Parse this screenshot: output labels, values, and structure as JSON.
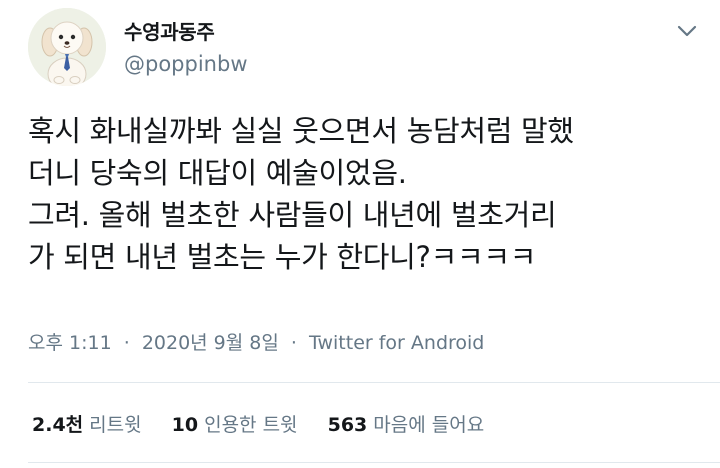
{
  "user": {
    "name": "수영과동주",
    "handle": "@poppinbw"
  },
  "tweet": {
    "lines": [
      "혹시 화내실까봐 실실 웃으면서 농담처럼 말했",
      "더니 당숙의 대답이 예술이었음.",
      "그려. 올해 벌초한 사람들이 내년에 벌초거리",
      "가 되면 내년 벌초는 누가 한다니?ㅋㅋㅋㅋ"
    ]
  },
  "meta": {
    "time": "오후 1:11",
    "separator": "·",
    "date": "2020년 9월 8일",
    "source": "Twitter for Android"
  },
  "stats": {
    "retweets": {
      "count": "2.4천",
      "label": "리트윗"
    },
    "quotes": {
      "count": "10",
      "label": "인용한 트윗"
    },
    "likes": {
      "count": "563",
      "label": "마음에 들어요"
    }
  },
  "icons": {
    "avatar": "puppy-avatar-icon",
    "menu": "chevron-down-icon"
  },
  "colors": {
    "text": "#14171a",
    "secondary": "#657786",
    "divider": "#e1e8ed"
  }
}
